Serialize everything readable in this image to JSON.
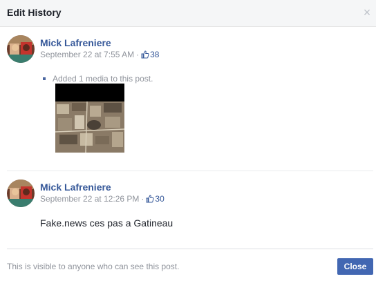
{
  "dialog": {
    "title": "Edit History",
    "close_icon": "close-icon"
  },
  "entries": [
    {
      "author": "Mick Lafreniere",
      "timestamp": "September 22 at 7:55 AM",
      "separator": "·",
      "like_count": "38",
      "change_note": "Added 1 media to this post."
    },
    {
      "author": "Mick Lafreniere",
      "timestamp": "September 22 at 12:26 PM",
      "separator": "·",
      "like_count": "30",
      "post_text": "Fake.news ces pas a Gatineau"
    }
  ],
  "footer": {
    "note": "This is visible to anyone who can see this post.",
    "close_label": "Close"
  },
  "colors": {
    "link": "#365899",
    "button": "#4267b2",
    "muted": "#90949c"
  }
}
